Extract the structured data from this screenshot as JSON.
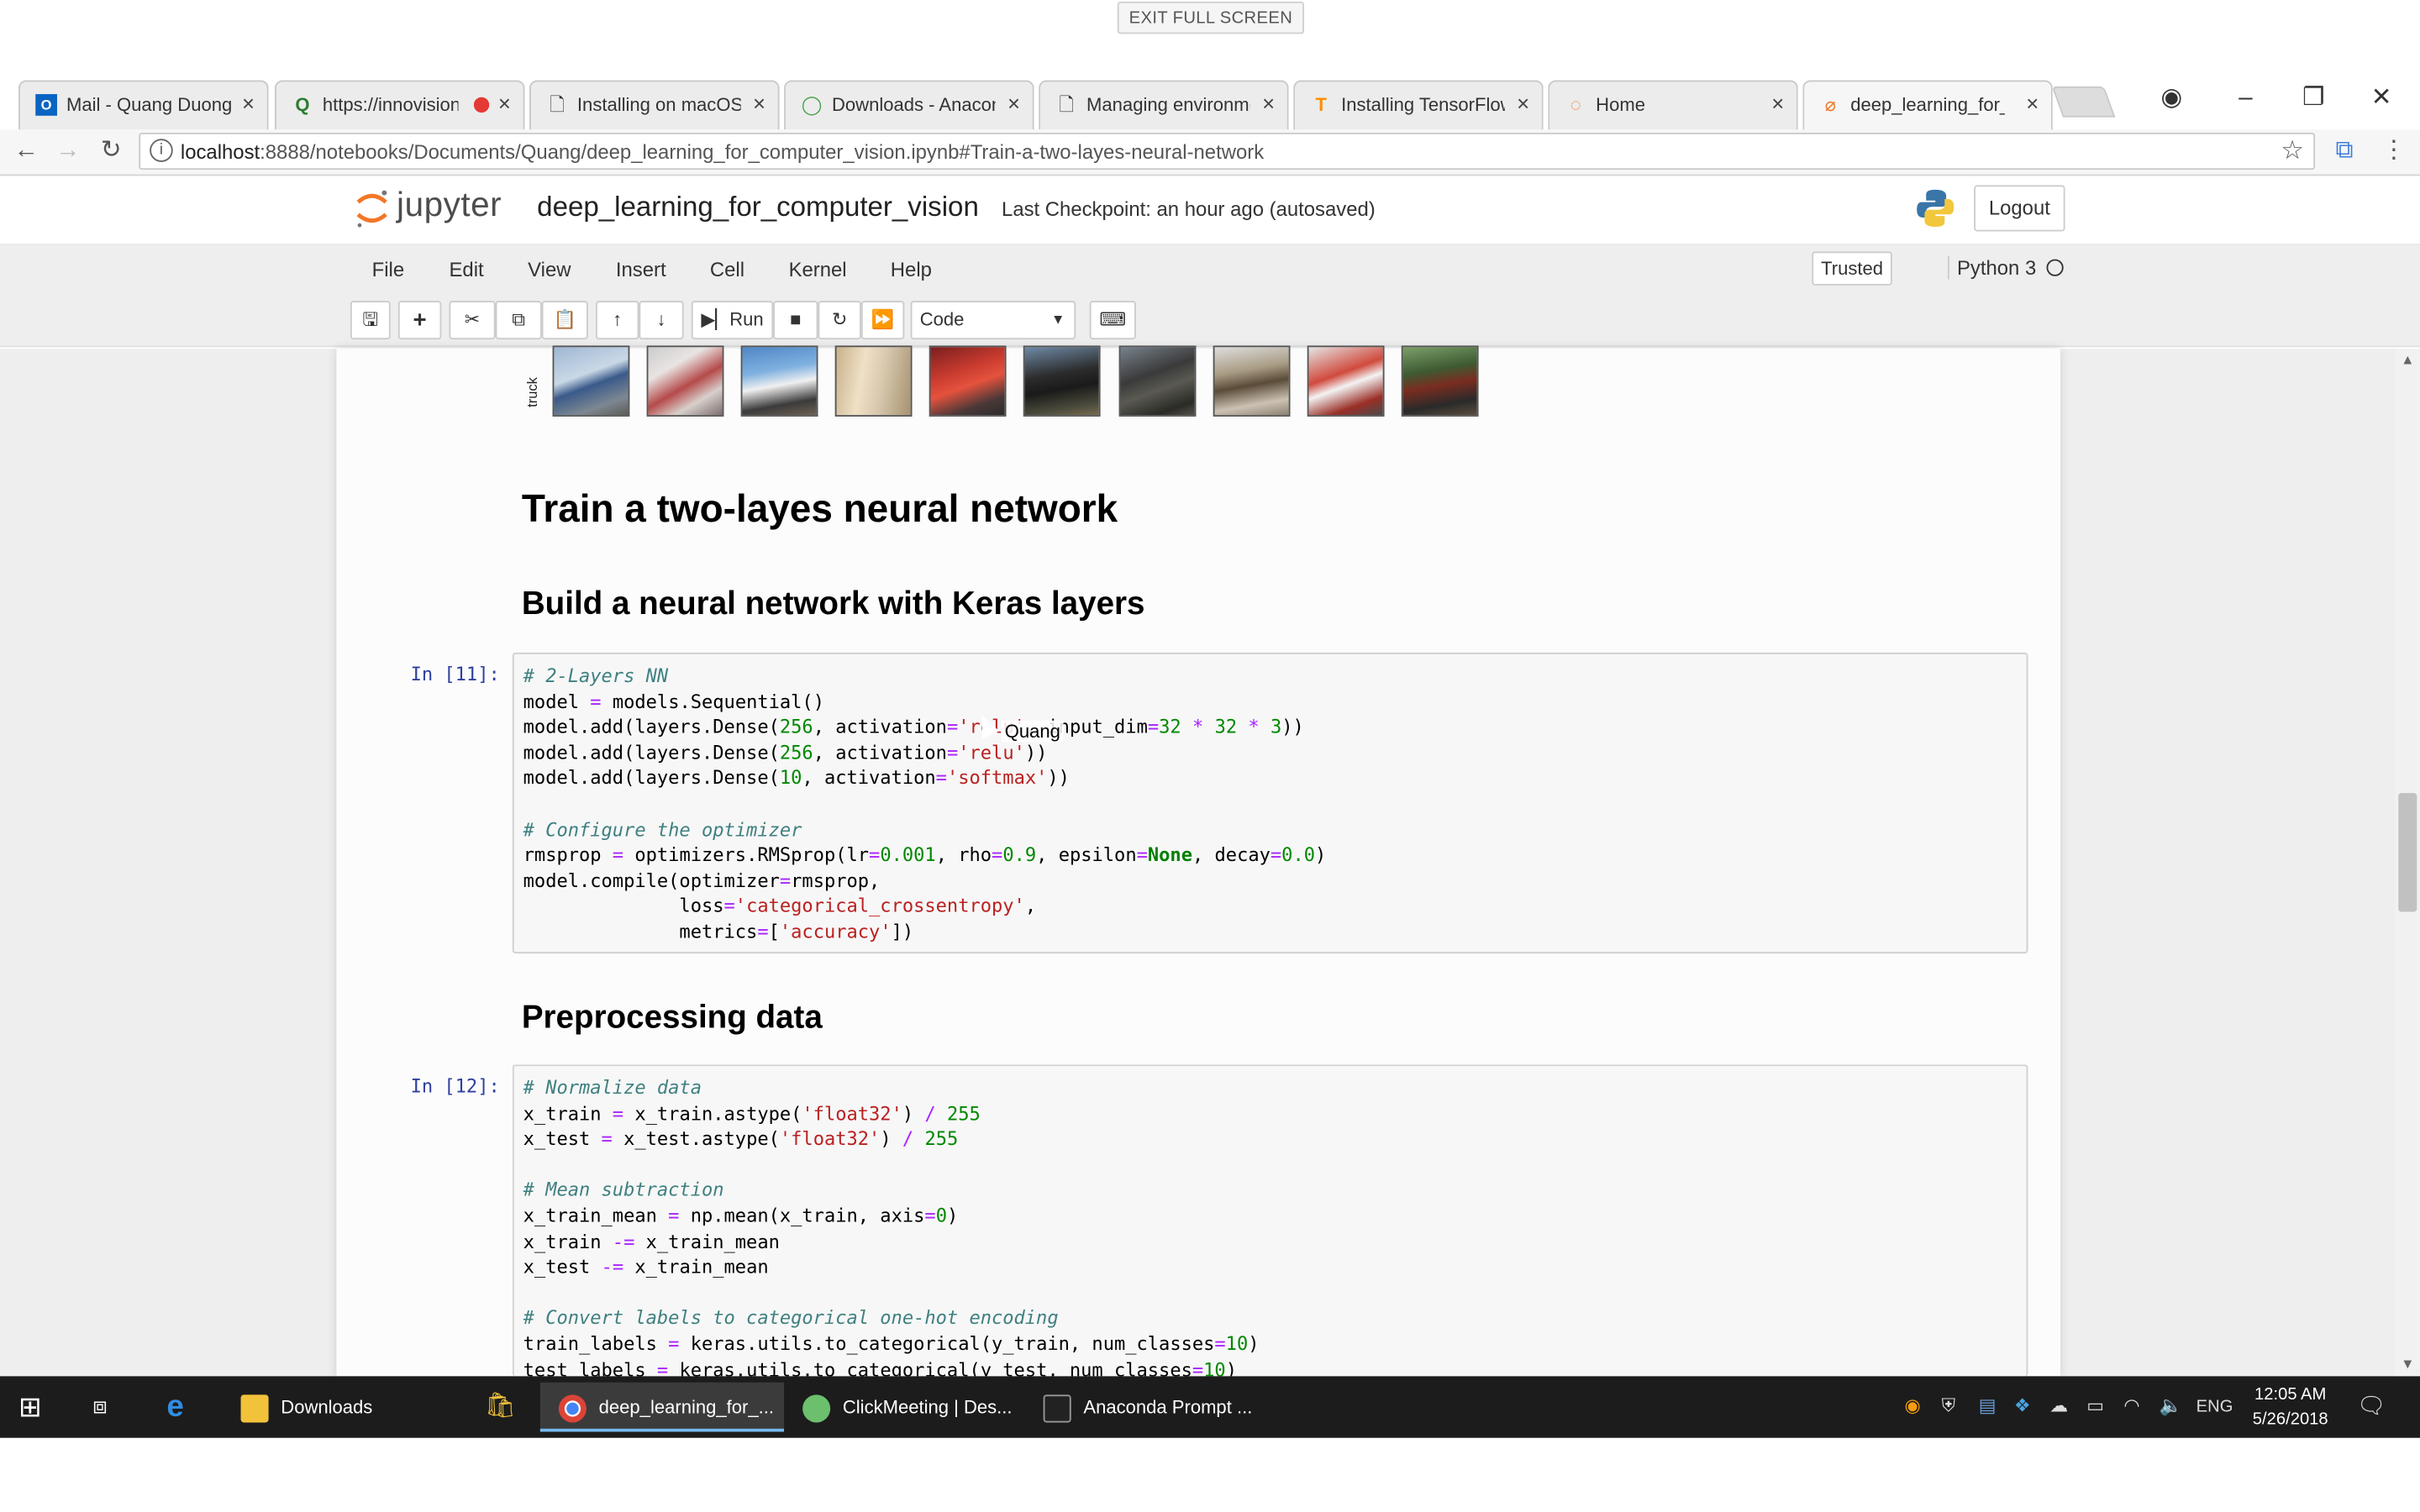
{
  "fullscreen": {
    "exit_label": "EXIT FULL SCREEN"
  },
  "browser": {
    "tabs": [
      {
        "label": "Mail - Quang Duong",
        "icon": "outlook-icon"
      },
      {
        "label": "https://innovision",
        "icon": "clickmeeting-icon"
      },
      {
        "label": "Installing on macOS",
        "icon": "page-icon"
      },
      {
        "label": "Downloads - Anacon",
        "icon": "anaconda-icon"
      },
      {
        "label": "Managing environme",
        "icon": "page-icon"
      },
      {
        "label": "Installing TensorFlow",
        "icon": "tensorflow-icon"
      },
      {
        "label": "Home",
        "icon": "jupyter-icon"
      },
      {
        "label": "deep_learning_for_c",
        "icon": "jupyter-icon"
      }
    ],
    "url_host": "localhost",
    "url_rest": ":8888/notebooks/Documents/Quang/deep_learning_for_computer_vision.ipynb#Train-a-two-layes-neural-network"
  },
  "jupyter": {
    "brand": "jupyter",
    "notebook_name": "deep_learning_for_computer_vision",
    "checkpoint": "Last Checkpoint: an hour ago  (autosaved)",
    "logout": "Logout",
    "menu": [
      "File",
      "Edit",
      "View",
      "Insert",
      "Cell",
      "Kernel",
      "Help"
    ],
    "trusted": "Trusted",
    "kernel": "Python 3",
    "toolbar": {
      "run": "Run",
      "cell_type": "Code"
    }
  },
  "notebook": {
    "image_row_label": "truck",
    "heading1": "Train a two-layes neural network",
    "heading2a": "Build a neural network with Keras layers",
    "prompt11": "In [11]:",
    "heading2b": "Preprocessing data",
    "prompt12": "In [12]:",
    "cursor_label": "Quang"
  },
  "taskbar": {
    "items": [
      "Downloads",
      "deep_learning_for_...",
      "ClickMeeting | Des...",
      "Anaconda Prompt ..."
    ],
    "lang": "ENG",
    "time": "12:05 AM",
    "date": "5/26/2018"
  },
  "colors": {
    "jupyter_orange": "#F37726",
    "prompt_blue": "#303F9F",
    "taskbar": "#1c1c1c"
  }
}
